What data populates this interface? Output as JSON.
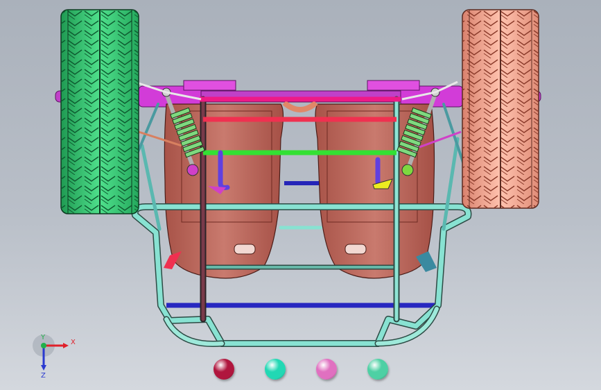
{
  "viewport": {
    "background_top": "#aab1bb",
    "background_bottom": "#d4d8de"
  },
  "model": {
    "left_wheel_color": "#3ec97a",
    "right_wheel_color": "#f2a893",
    "frame_color": "#86e0cf",
    "seat_color": "#c4746a",
    "cross_bar_magenta": "#ee1a86",
    "cross_bar_red": "#f03050",
    "cross_bar_green": "#33e033",
    "cross_bar_blue": "#2525b8",
    "axle_color": "#d23cd8",
    "shock_color": "#7fd97f"
  },
  "triad": {
    "x_label": "X",
    "y_label": "Y",
    "z_label": "Z",
    "x_color": "#e0202a",
    "y_color": "#22b04a",
    "z_color": "#2a3ad0"
  },
  "appearance_swatches": [
    {
      "name": "maroon-appearance",
      "color": "#b0163e"
    },
    {
      "name": "aqua-appearance",
      "color": "#22d8b4"
    },
    {
      "name": "pink-appearance",
      "color": "#e070c0"
    },
    {
      "name": "seafoam-appearance",
      "color": "#4ed0a4"
    }
  ]
}
